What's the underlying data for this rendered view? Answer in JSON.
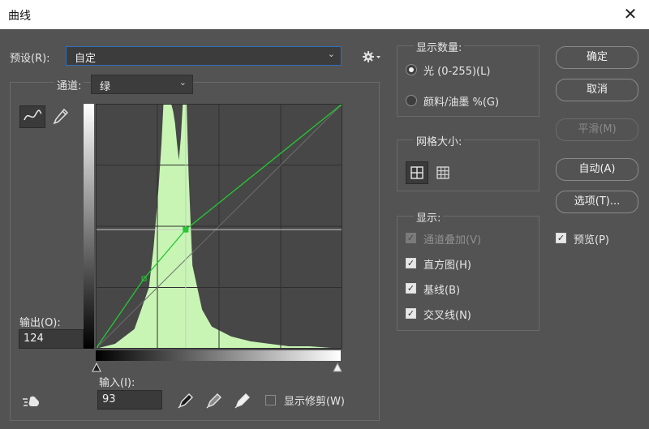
{
  "window": {
    "title": "曲线",
    "close_glyph": "✕"
  },
  "preset": {
    "label": "预设(R):",
    "value": "自定"
  },
  "channel": {
    "label": "通道:",
    "value": "绿"
  },
  "output": {
    "label": "输出(O):",
    "value": "124"
  },
  "input": {
    "label": "输入(I):",
    "value": "93"
  },
  "show_clipping": {
    "label": "显示修剪(W)",
    "checked": false
  },
  "show_amount": {
    "title": "显示数量:",
    "options": [
      "光 (0-255)(L)",
      "颜料/油墨 %(G)"
    ],
    "selected": 0
  },
  "grid_size": {
    "title": "网格大小:"
  },
  "display": {
    "title": "显示:",
    "options": [
      {
        "label": "通道叠加(V)",
        "checked": true,
        "disabled": true
      },
      {
        "label": "直方图(H)",
        "checked": true,
        "disabled": false
      },
      {
        "label": "基线(B)",
        "checked": true,
        "disabled": false
      },
      {
        "label": "交叉线(N)",
        "checked": true,
        "disabled": false
      }
    ]
  },
  "buttons": {
    "ok": "确定",
    "cancel": "取消",
    "smooth": "平滑(M)",
    "auto": "自动(A)",
    "options": "选项(T)..."
  },
  "preview": {
    "label": "预览(P)",
    "checked": true
  },
  "check_glyph": "✓",
  "colors": {
    "histogram": "#c8f5b4",
    "curve": "#23c832",
    "graph_bg": "#474747",
    "accent_focus": "#2f6fb8"
  },
  "icons": [
    "close-icon",
    "gear-icon",
    "curve-tool-icon",
    "pencil-icon",
    "grid-4-icon",
    "grid-10-icon",
    "black-point-eyedropper-icon",
    "gray-point-eyedropper-icon",
    "white-point-eyedropper-icon",
    "target-adjust-icon",
    "black-slider-icon",
    "white-slider-icon"
  ],
  "chart_data": {
    "type": "area",
    "x_range": [
      0,
      255
    ],
    "y_range": [
      0,
      255
    ],
    "histogram": {
      "x": [
        0,
        20,
        40,
        55,
        60,
        65,
        68,
        70,
        72,
        74,
        76,
        78,
        80,
        82,
        84,
        86,
        88,
        90,
        92,
        94,
        96,
        100,
        110,
        120,
        140,
        160,
        180,
        200,
        220,
        255
      ],
      "y": [
        0,
        0.02,
        0.08,
        0.25,
        0.42,
        0.66,
        0.84,
        1.0,
        1.0,
        1.0,
        1.0,
        1.0,
        0.97,
        0.92,
        0.84,
        0.77,
        0.86,
        1.0,
        1.0,
        1.0,
        0.72,
        0.34,
        0.16,
        0.09,
        0.05,
        0.03,
        0.02,
        0.01,
        0.01,
        0.0
      ]
    },
    "curve_points": [
      [
        0,
        0
      ],
      [
        50,
        73
      ],
      [
        93,
        124
      ],
      [
        255,
        255
      ]
    ],
    "grid": "4x4"
  }
}
